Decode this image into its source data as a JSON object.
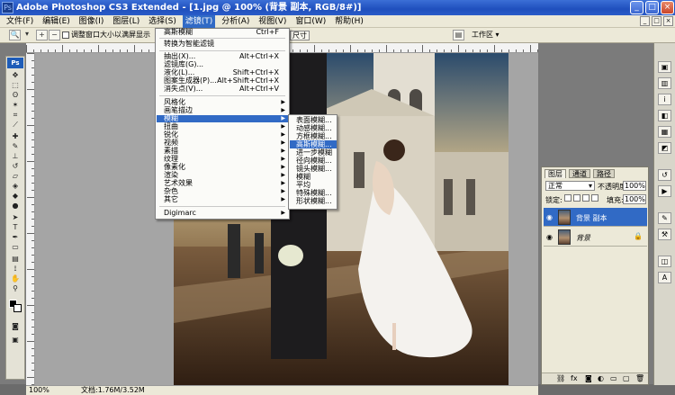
{
  "window": {
    "title": "Adobe Photoshop CS3 Extended - [1.jpg @ 100% (背景 副本, RGB/8#)]",
    "app_icon_label": "Ps",
    "minimize": "_",
    "restore": "□",
    "close": "×"
  },
  "menubar": {
    "items": [
      "文件(F)",
      "编辑(E)",
      "图像(I)",
      "图层(L)",
      "选择(S)",
      "滤镜(T)",
      "分析(A)",
      "视图(V)",
      "窗口(W)",
      "帮助(H)"
    ],
    "active": "滤镜(T)"
  },
  "options_bar": {
    "tool_icon": "zoom-icon",
    "resize_checkbox_label": "调整窗口大小以满屏显示",
    "partial_label": "尺寸",
    "workspace_label": "工作区 ▾"
  },
  "filter_menu": {
    "items": [
      {
        "label": "高斯模糊",
        "shortcut": "Ctrl+F"
      },
      {
        "label": "转换为智能滤镜",
        "shortcut": ""
      },
      {
        "label": "抽出(X)...",
        "shortcut": "Alt+Ctrl+X"
      },
      {
        "label": "滤镜库(G)...",
        "shortcut": ""
      },
      {
        "label": "液化(L)...",
        "shortcut": "Shift+Ctrl+X"
      },
      {
        "label": "图案生成器(P)...",
        "shortcut": "Alt+Shift+Ctrl+X"
      },
      {
        "label": "消失点(V)...",
        "shortcut": "Alt+Ctrl+V"
      },
      {
        "label": "风格化",
        "shortcut": ""
      },
      {
        "label": "画笔描边",
        "shortcut": ""
      },
      {
        "label": "模糊",
        "shortcut": ""
      },
      {
        "label": "扭曲",
        "shortcut": ""
      },
      {
        "label": "锐化",
        "shortcut": ""
      },
      {
        "label": "视频",
        "shortcut": ""
      },
      {
        "label": "素描",
        "shortcut": ""
      },
      {
        "label": "纹理",
        "shortcut": ""
      },
      {
        "label": "像素化",
        "shortcut": ""
      },
      {
        "label": "渲染",
        "shortcut": ""
      },
      {
        "label": "艺术效果",
        "shortcut": ""
      },
      {
        "label": "杂色",
        "shortcut": ""
      },
      {
        "label": "其它",
        "shortcut": ""
      },
      {
        "label": "Digimarc",
        "shortcut": ""
      }
    ],
    "highlighted": "模糊"
  },
  "blur_submenu": {
    "items": [
      "表面模糊...",
      "动感模糊...",
      "方框模糊...",
      "高斯模糊...",
      "进一步模糊",
      "径向模糊...",
      "镜头模糊...",
      "模糊",
      "平均",
      "特殊模糊...",
      "形状模糊..."
    ],
    "highlighted": "高斯模糊..."
  },
  "layers_panel": {
    "tabs": [
      "图层",
      "通道",
      "路径"
    ],
    "active_tab": "图层",
    "blend_mode": "正常",
    "opacity_label": "不透明度:",
    "opacity_value": "100%",
    "lock_label": "锁定:",
    "fill_label": "填充:",
    "fill_value": "100%",
    "layers": [
      {
        "name": "背景 副本",
        "selected": true
      },
      {
        "name": "背景",
        "selected": false
      }
    ]
  },
  "statusbar": {
    "zoom": "100%",
    "doc_info": "文档:1.76M/3.52M"
  },
  "colors": {
    "titlebar": "#1f4fbd",
    "menu_highlight": "#316ac5",
    "chrome": "#ece9d8"
  }
}
